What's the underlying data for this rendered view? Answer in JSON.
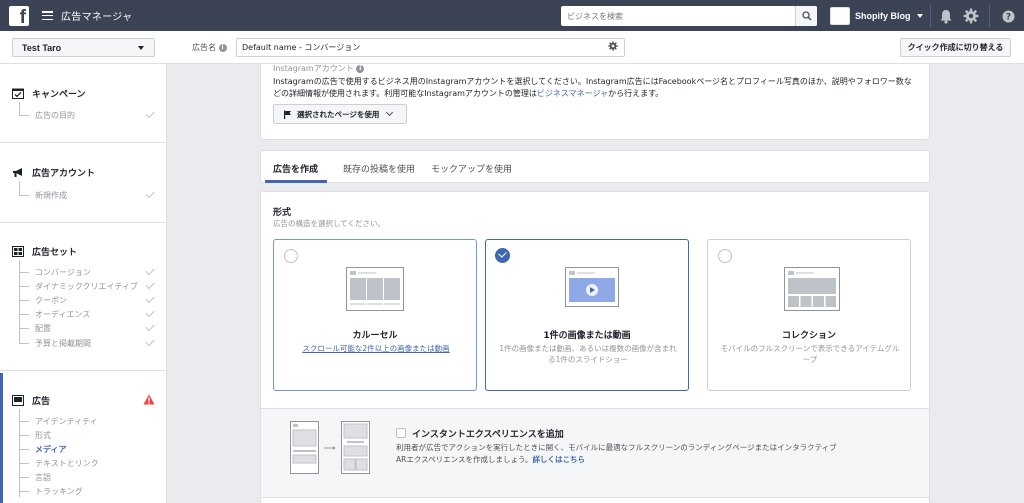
{
  "topbar": {
    "app_title": "広告マネージャ",
    "search_placeholder": "ビジネスを検索",
    "account_name": "Shopify Blog",
    "icons": [
      "facebook-logo",
      "hamburger-icon",
      "search-icon",
      "bell-icon",
      "gear-icon",
      "help-icon"
    ]
  },
  "subbar": {
    "account_select": "Test Taro",
    "ad_name_label": "広告名",
    "ad_name_value": "Default name - コンバージョン",
    "quick_create": "クイック作成に切り替える"
  },
  "sidebar": {
    "campaign": {
      "label": "キャンペーン",
      "items": [
        "広告の目的"
      ]
    },
    "ad_account": {
      "label": "広告アカウント",
      "items": [
        "新規作成"
      ]
    },
    "ad_set": {
      "label": "広告セット",
      "items": [
        "コンバージョン",
        "ダイナミッククリエイティブ",
        "クーポン",
        "オーディエンス",
        "配置",
        "予算と掲載期間"
      ]
    },
    "ad": {
      "label": "広告",
      "items": [
        "アイデンティティ",
        "形式",
        "メディア",
        "テキストとリンク",
        "言語",
        "トラッキング"
      ],
      "active_item": "メディア"
    }
  },
  "instagram": {
    "title": "Instagramアカウント",
    "desc_before_link": "Instagramの広告で使用するビジネス用のInstagramアカウントを選択してください。Instagram広告にはFacebookページ名とプロフィール写真のほか、説明やフォロワー数などの詳細情報が使用されます。利用可能なInstagramアカウントの管理は",
    "desc_link": "ビジネスマネージャ",
    "desc_after_link": "から行えます。",
    "page_button": "選択されたページを使用"
  },
  "tabs": [
    "広告を作成",
    "既存の投稿を使用",
    "モックアップを使用"
  ],
  "format": {
    "title": "形式",
    "subtitle": "広告の構造を選択してください。",
    "options": [
      {
        "name": "カルーセル",
        "desc": "スクロール可能な2件以上の画像または動画",
        "selected": false
      },
      {
        "name": "1件の画像または動画",
        "desc": "1件の画像または動画、あるいは複数の画像が含まれる1件のスライドショー",
        "selected": true
      },
      {
        "name": "コレクション",
        "desc": "モバイルのフルスクリーンで表示できるアイテムグループ",
        "selected": false
      }
    ]
  },
  "instant_experience": {
    "title": "インスタントエクスペリエンスを追加",
    "desc": "利用者が広告でアクションを実行したときに開く、モバイルに最適なフルスクリーンのランディングページまたはインタラクティブARエクスペリエンスを作成しましょう。",
    "link": "詳しくはこちら"
  },
  "colors": {
    "topbar": "#3b4355",
    "accent": "#4267b2",
    "warning": "#fa3e3e"
  }
}
